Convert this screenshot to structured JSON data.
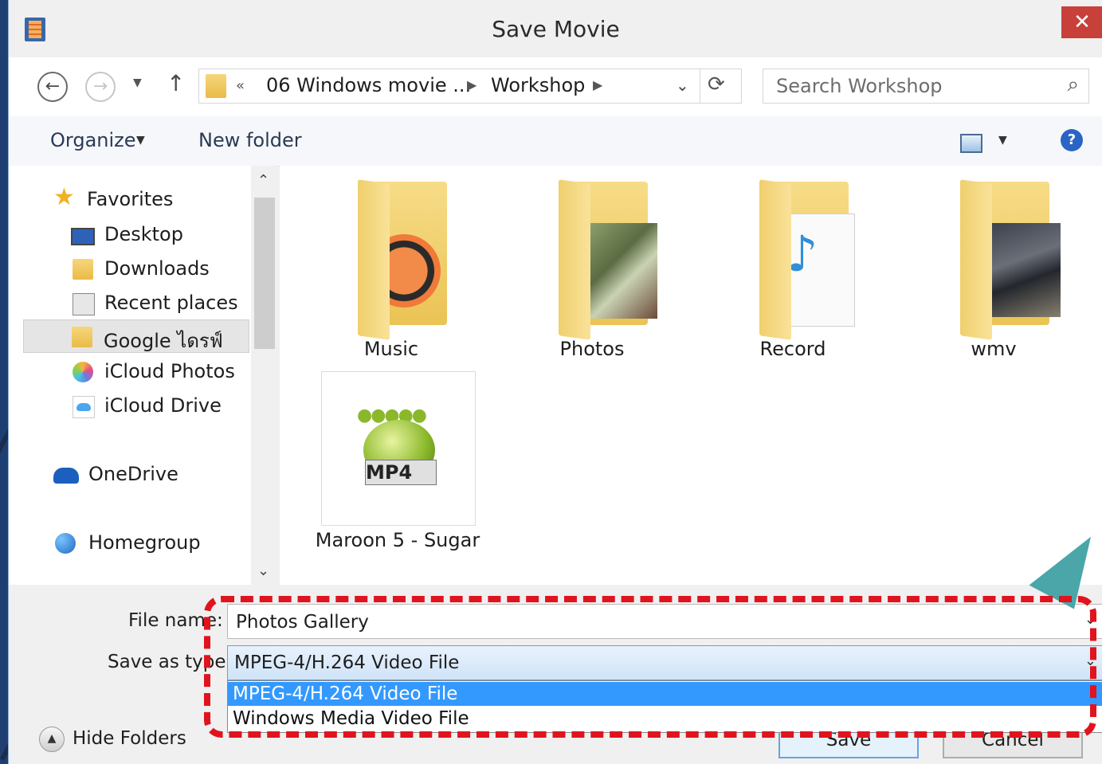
{
  "window": {
    "title": "Save Movie",
    "close_glyph": "✕",
    "app_icon": "film-icon"
  },
  "nav": {
    "back_glyph": "←",
    "forward_glyph": "→",
    "recent_glyph": "▼",
    "up_glyph": "↑",
    "breadcrumb": {
      "chevron": "«",
      "items": [
        "06 Windows movie ...",
        "Workshop"
      ],
      "sep": "▶",
      "dropdown": "⌄",
      "refresh": "⟳"
    },
    "search": {
      "placeholder": "Search Workshop",
      "icon": "⌕"
    }
  },
  "toolbar": {
    "organize": "Organize",
    "organize_caret": "▼",
    "new_folder": "New folder",
    "view_caret": "▼",
    "help": "?"
  },
  "sidebar": {
    "items": [
      {
        "label": "Favorites",
        "icon": "star-icon"
      },
      {
        "label": "Desktop",
        "icon": "desktop-icon"
      },
      {
        "label": "Downloads",
        "icon": "downloads-folder-icon"
      },
      {
        "label": "Recent places",
        "icon": "recent-places-icon"
      },
      {
        "label": "Google ไดรฟ์",
        "icon": "google-drive-folder-icon"
      },
      {
        "label": "iCloud Photos",
        "icon": "icloud-photos-icon"
      },
      {
        "label": "iCloud Drive",
        "icon": "icloud-drive-icon"
      },
      {
        "label": "OneDrive",
        "icon": "onedrive-icon"
      },
      {
        "label": "Homegroup",
        "icon": "homegroup-icon"
      }
    ],
    "scroll_up": "⌃",
    "scroll_down": "⌄"
  },
  "files": [
    {
      "label": "Music",
      "type": "folder"
    },
    {
      "label": "Photos",
      "type": "folder"
    },
    {
      "label": "Record",
      "type": "folder"
    },
    {
      "label": "wmv",
      "type": "folder"
    },
    {
      "label": "Maroon 5 - Sugar",
      "type": "mp4",
      "badge": "MP4"
    }
  ],
  "form": {
    "file_name_label": "File name:",
    "file_name_value": "Photos Gallery",
    "save_type_label": "Save as type:",
    "save_type_value": "MPEG-4/H.264 Video File",
    "options": [
      "MPEG-4/H.264 Video File",
      "Windows Media Video File"
    ],
    "dropdown_glyph": "⌄",
    "save": "Save",
    "cancel": "Cancel",
    "hide_folders": "Hide Folders",
    "hide_glyph": "▲"
  },
  "colors": {
    "annotation": "#e0141e",
    "selection": "#3399ff",
    "callout": "#4aa6a8"
  }
}
